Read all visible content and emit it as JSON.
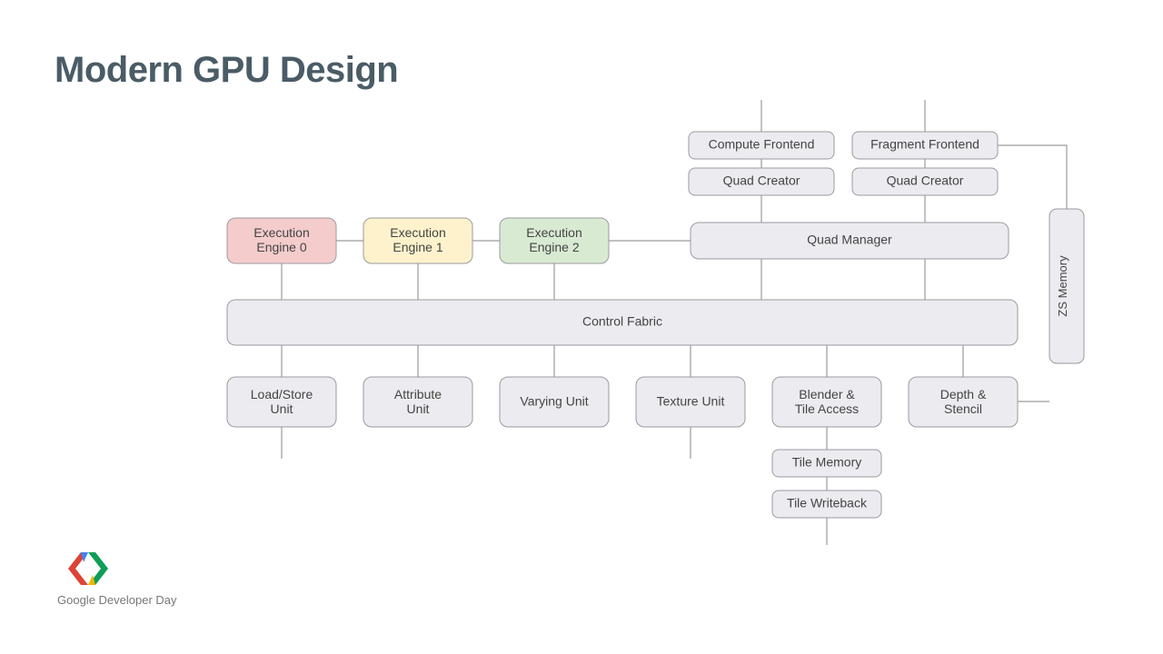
{
  "title": "Modern GPU Design",
  "blocks": {
    "execEngine0": "Execution\nEngine 0",
    "execEngine1": "Execution\nEngine 1",
    "execEngine2": "Execution\nEngine 2",
    "computeFrontend": "Compute Frontend",
    "fragmentFrontend": "Fragment Frontend",
    "quadCreatorA": "Quad Creator",
    "quadCreatorB": "Quad Creator",
    "quadManager": "Quad Manager",
    "controlFabric": "Control Fabric",
    "loadStore": "Load/Store\nUnit",
    "attribute": "Attribute\nUnit",
    "varying": "Varying Unit",
    "texture": "Texture  Unit",
    "blender": "Blender &\nTile Access",
    "depthStencil": "Depth &\nStencil",
    "tileMemory": "Tile Memory",
    "tileWriteback": "Tile Writeback",
    "zsMemory": "ZS Memory"
  },
  "footer": {
    "brand1": "Google",
    "brand2": " Developer Day"
  },
  "colors": {
    "red": "#f4cccc",
    "yellow": "#fdf2cc",
    "green": "#d8ead2",
    "grey": "#ecebef"
  }
}
